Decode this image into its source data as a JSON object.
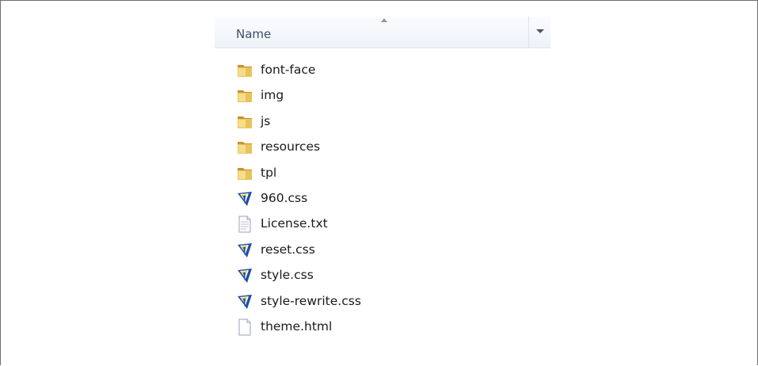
{
  "header": {
    "name_column_label": "Name",
    "sort_icon": "sort-ascending-icon",
    "dropdown_icon": "chevron-down-icon"
  },
  "files": [
    {
      "name": "font-face",
      "icon": "folder-icon"
    },
    {
      "name": "img",
      "icon": "folder-icon"
    },
    {
      "name": "js",
      "icon": "folder-icon"
    },
    {
      "name": "resources",
      "icon": "folder-icon"
    },
    {
      "name": "tpl",
      "icon": "folder-icon"
    },
    {
      "name": "960.css",
      "icon": "css-file-icon"
    },
    {
      "name": "License.txt",
      "icon": "text-file-icon"
    },
    {
      "name": "reset.css",
      "icon": "css-file-icon"
    },
    {
      "name": "style.css",
      "icon": "css-file-icon"
    },
    {
      "name": "style-rewrite.css",
      "icon": "css-file-icon"
    },
    {
      "name": "theme.html",
      "icon": "blank-file-icon"
    }
  ],
  "colors": {
    "folder": "#e9c25a",
    "folder_dark": "#c9922e",
    "css_blue": "#1f4fa3",
    "header_text": "#3e4f6b"
  }
}
